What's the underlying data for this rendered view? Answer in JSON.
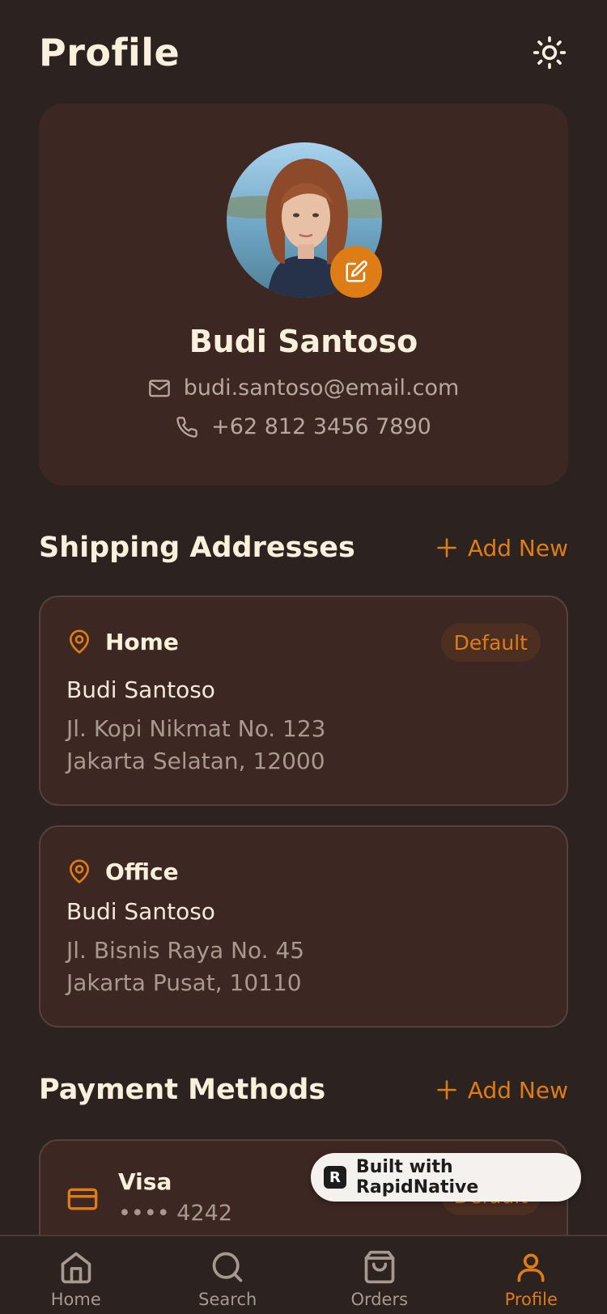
{
  "header": {
    "title": "Profile",
    "theme_icon": "sun-icon"
  },
  "profile": {
    "name": "Budi Santoso",
    "email": "budi.santoso@email.com",
    "phone": "+62 812 3456 7890",
    "edit_icon": "edit-icon"
  },
  "shipping": {
    "title": "Shipping Addresses",
    "add_label": "Add New",
    "addresses": [
      {
        "label": "Home",
        "name": "Budi Santoso",
        "line1": "Jl. Kopi Nikmat No. 123",
        "line2": "Jakarta Selatan, 12000",
        "badge": "Default"
      },
      {
        "label": "Office",
        "name": "Budi Santoso",
        "line1": "Jl. Bisnis Raya No. 45",
        "line2": "Jakarta Pusat, 10110"
      }
    ]
  },
  "payment": {
    "title": "Payment Methods",
    "add_label": "Add New",
    "methods": [
      {
        "name": "Visa",
        "number": "•••• 4242",
        "badge": "Default"
      }
    ]
  },
  "built_with": {
    "label": "Built with RapidNative"
  },
  "nav": {
    "items": [
      {
        "label": "Home",
        "icon": "home-icon",
        "active": false
      },
      {
        "label": "Search",
        "icon": "search-icon",
        "active": false
      },
      {
        "label": "Orders",
        "icon": "shopping-bag-icon",
        "active": false
      },
      {
        "label": "Profile",
        "icon": "user-icon",
        "active": true
      }
    ]
  },
  "colors": {
    "background": "#2c2220",
    "card": "#3d2723",
    "accent": "#de7c16",
    "text_primary": "#fbf0dc",
    "text_muted": "#a8998e"
  }
}
